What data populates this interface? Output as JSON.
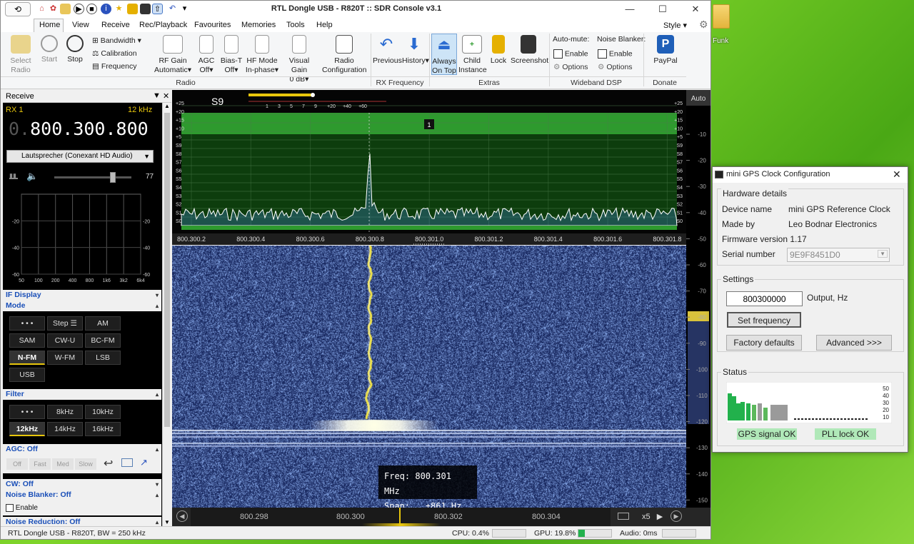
{
  "window": {
    "title": "RTL Dongle USB - R820T :: SDR Console v3.1",
    "style_label": "Style"
  },
  "desktop": {
    "folder_label": "Funk"
  },
  "menu": [
    "Home",
    "View",
    "Receive",
    "Rec/Playback",
    "Favourites",
    "Memories",
    "Tools",
    "Help"
  ],
  "ribbon": {
    "radio": {
      "select_radio": "Select Radio",
      "start": "Start",
      "stop": "Stop",
      "bandwidth": "Bandwidth",
      "calibration": "Calibration",
      "frequency": "Frequency",
      "rf_gain": "RF Gain",
      "rf_gain_val": "Automatic",
      "agc": "AGC",
      "agc_val": "Off",
      "bias_t": "Bias-T",
      "bias_t_val": "Off",
      "hf_mode": "HF Mode",
      "hf_mode_val": "In-phase",
      "visual_gain": "Visual Gain",
      "visual_gain_val": "0 dB",
      "radio_config": "Radio",
      "radio_config2": "Configuration",
      "group": "Radio"
    },
    "rxfreq": {
      "previous": "Previous",
      "history": "History",
      "group": "RX Frequency"
    },
    "extras": {
      "always": "Always",
      "on_top": "On Top",
      "child": "Child",
      "instance": "Instance",
      "lock": "Lock",
      "screenshot": "Screenshot",
      "group": "Extras"
    },
    "wideband": {
      "automute": "Auto-mute:",
      "enable": "Enable",
      "options": "Options",
      "noise_blanker": "Noise Blanker:",
      "group": "Wideband DSP"
    },
    "donate": {
      "paypal": "PayPal",
      "group": "Donate"
    }
  },
  "receive": {
    "header": "Receive",
    "rx": "RX 1",
    "bw": "12 kHz",
    "freq_prefix": "0.",
    "freq": "800.300.800",
    "audio_device": "Lautsprecher (Conexant HD Audio)",
    "volume": "77",
    "if_y_labels": [
      "-20",
      "-40",
      "-60"
    ],
    "if_x_labels": [
      "50",
      "100",
      "200",
      "400",
      "800",
      "1k6",
      "3k2",
      "6k4"
    ],
    "if_display": "IF Display",
    "mode": "Mode",
    "modes": [
      "• • •",
      "Step ☰",
      "AM",
      "SAM",
      "CW-U",
      "BC-FM",
      "N-FM",
      "W-FM",
      "LSB",
      "USB"
    ],
    "filter": "Filter",
    "filters": [
      "• • •",
      "8kHz",
      "10kHz",
      "12kHz",
      "14kHz",
      "16kHz"
    ],
    "agc": "AGC: Off",
    "agc_btns": [
      "Off",
      "Fast",
      "Med",
      "Slow"
    ],
    "cw": "CW: Off",
    "noise_blanker": "Noise Blanker: Off",
    "nb_enable": "Enable",
    "noise_reduction": "Noise Reduction: Off"
  },
  "spectrum": {
    "smeter": "S9",
    "smeter_scale": [
      "1",
      "3",
      "5",
      "7",
      "9",
      "+20",
      "+40",
      "+60"
    ],
    "left_scale": [
      "+25",
      "+20",
      "+15",
      "+10",
      "+5",
      "S9",
      "S8",
      "S7",
      "S6",
      "S5",
      "S4",
      "S3",
      "S2",
      "S1",
      "S0"
    ],
    "marker": "1",
    "freq_axis": [
      "800.300.2",
      "800.300.4",
      "800.300.6",
      "800.300.8",
      "800.301.0",
      "800.301.2",
      "800.301.4",
      "800.301.6",
      "800.301.8"
    ],
    "auto": "Auto",
    "db_scale": [
      "-10",
      "-20",
      "-30",
      "-40",
      "-50",
      "-60",
      "-70",
      "-80",
      "-90",
      "-100",
      "-110",
      "-120",
      "-130",
      "-140",
      "-150"
    ]
  },
  "waterfall": {
    "freq_label": "Freq:",
    "freq_val": "800.301 MHz",
    "span_label": "Span:",
    "span_val": "±861 Hz"
  },
  "bottombar": {
    "scale": [
      "800.298",
      "800.300",
      "800.302",
      "800.304"
    ],
    "zoom": "x5"
  },
  "status": {
    "device": "RTL Dongle USB - R820T, BW = 250 kHz",
    "cpu": "CPU: 0.4%",
    "gpu": "GPU: 19.8%",
    "audio": "Audio: 0ms"
  },
  "gps": {
    "title": "mini GPS Clock Configuration",
    "hw_header": "Hardware details",
    "device_name_label": "Device name",
    "device_name": "mini GPS Reference Clock",
    "made_by_label": "Made by",
    "made_by": "Leo Bodnar Electronics",
    "firmware_label": "Firmware version",
    "firmware": "1.17",
    "serial_label": "Serial number",
    "serial": "9E9F8451D0",
    "settings_header": "Settings",
    "output_value": "800300000",
    "output_label": "Output, Hz",
    "set_freq": "Set frequency",
    "factory": "Factory defaults",
    "advanced": "Advanced >>>",
    "status_header": "Status",
    "chart_labels": [
      "50",
      "40",
      "30",
      "20",
      "10"
    ],
    "gps_ok": "GPS signal OK",
    "pll_ok": "PLL lock OK"
  },
  "colors": {
    "accent": "#e8c60c",
    "spectrum_green": "#2e9a2e",
    "waterfall_bg": "#1b2a63",
    "link_blue": "#1a4fb8"
  }
}
